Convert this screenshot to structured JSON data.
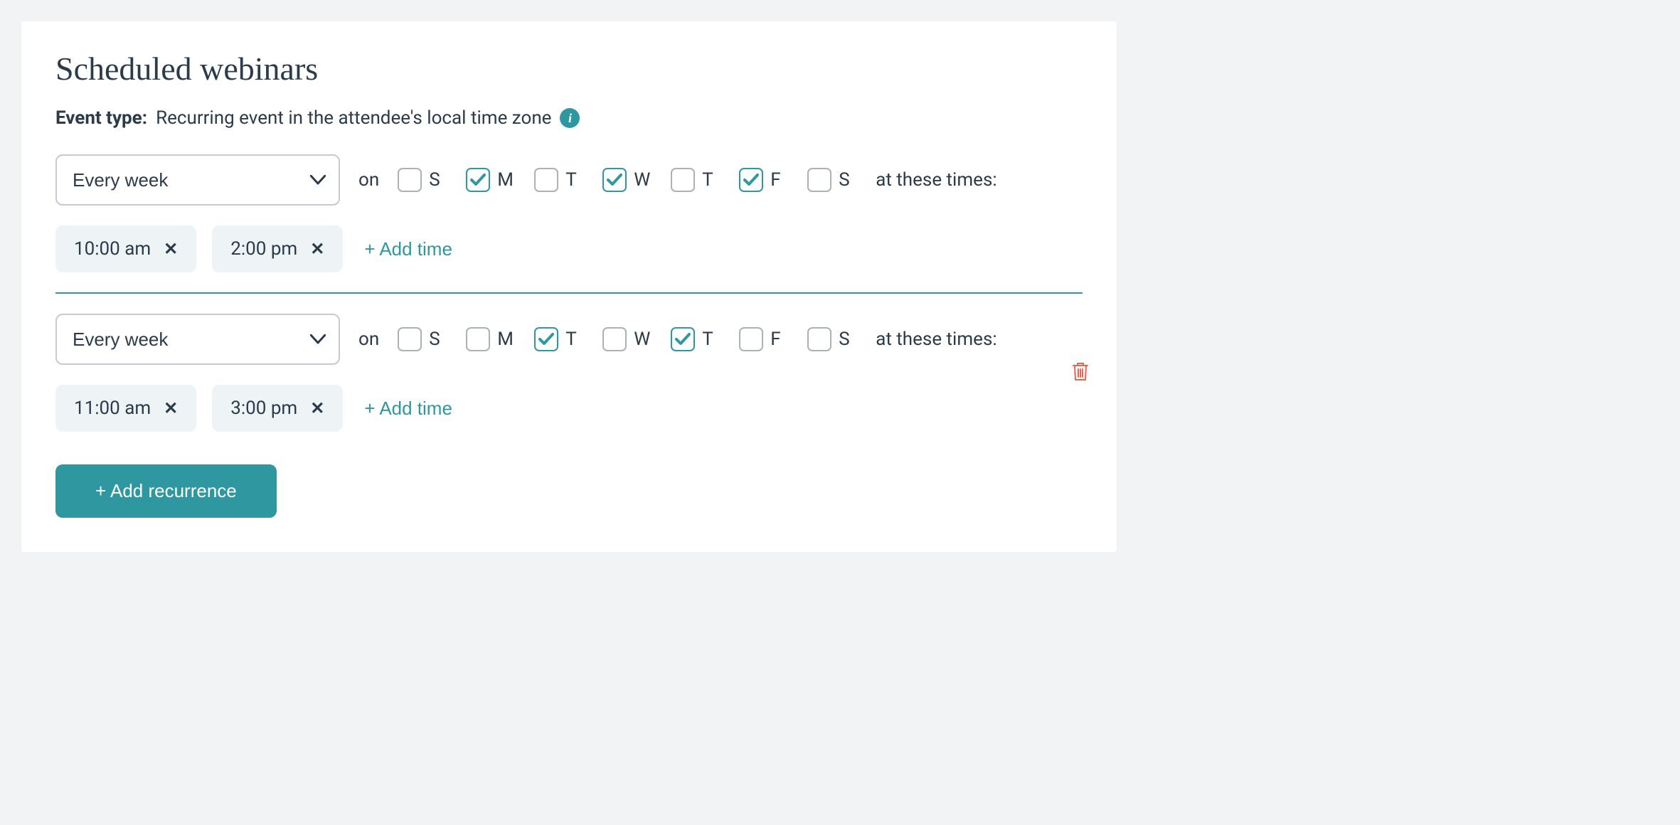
{
  "title": "Scheduled webinars",
  "eventType": {
    "label": "Event type:",
    "value": "Recurring event in the attendee's local time zone"
  },
  "labels": {
    "on": "on",
    "atTimes": "at these times:",
    "addTime": "+ Add time",
    "addRecurrence": "+ Add recurrence"
  },
  "dayLabels": [
    "S",
    "M",
    "T",
    "W",
    "T",
    "F",
    "S"
  ],
  "recurrences": [
    {
      "frequency": "Every week",
      "days": [
        false,
        true,
        false,
        true,
        false,
        true,
        false
      ],
      "times": [
        "10:00 am",
        "2:00 pm"
      ],
      "deletable": false
    },
    {
      "frequency": "Every week",
      "days": [
        false,
        false,
        true,
        false,
        true,
        false,
        false
      ],
      "times": [
        "11:00 am",
        "3:00 pm"
      ],
      "deletable": true
    }
  ]
}
